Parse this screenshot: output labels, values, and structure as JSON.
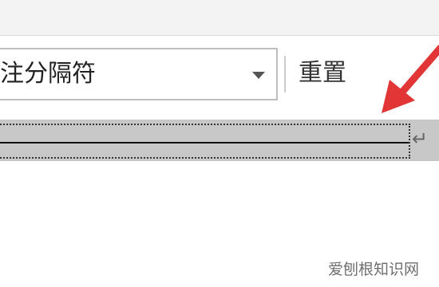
{
  "footnote_dialog": {
    "separator_dropdown": {
      "value": "注分隔符"
    },
    "reset_label": "重置",
    "paragraph_mark": "↵"
  },
  "annotation": {
    "arrow_color": "#e23636"
  },
  "watermark": {
    "text": "爱刨根知识网"
  },
  "colors": {
    "toolbar_background": "#f3f3f3",
    "separator_highlight": "#c8c8c8"
  }
}
